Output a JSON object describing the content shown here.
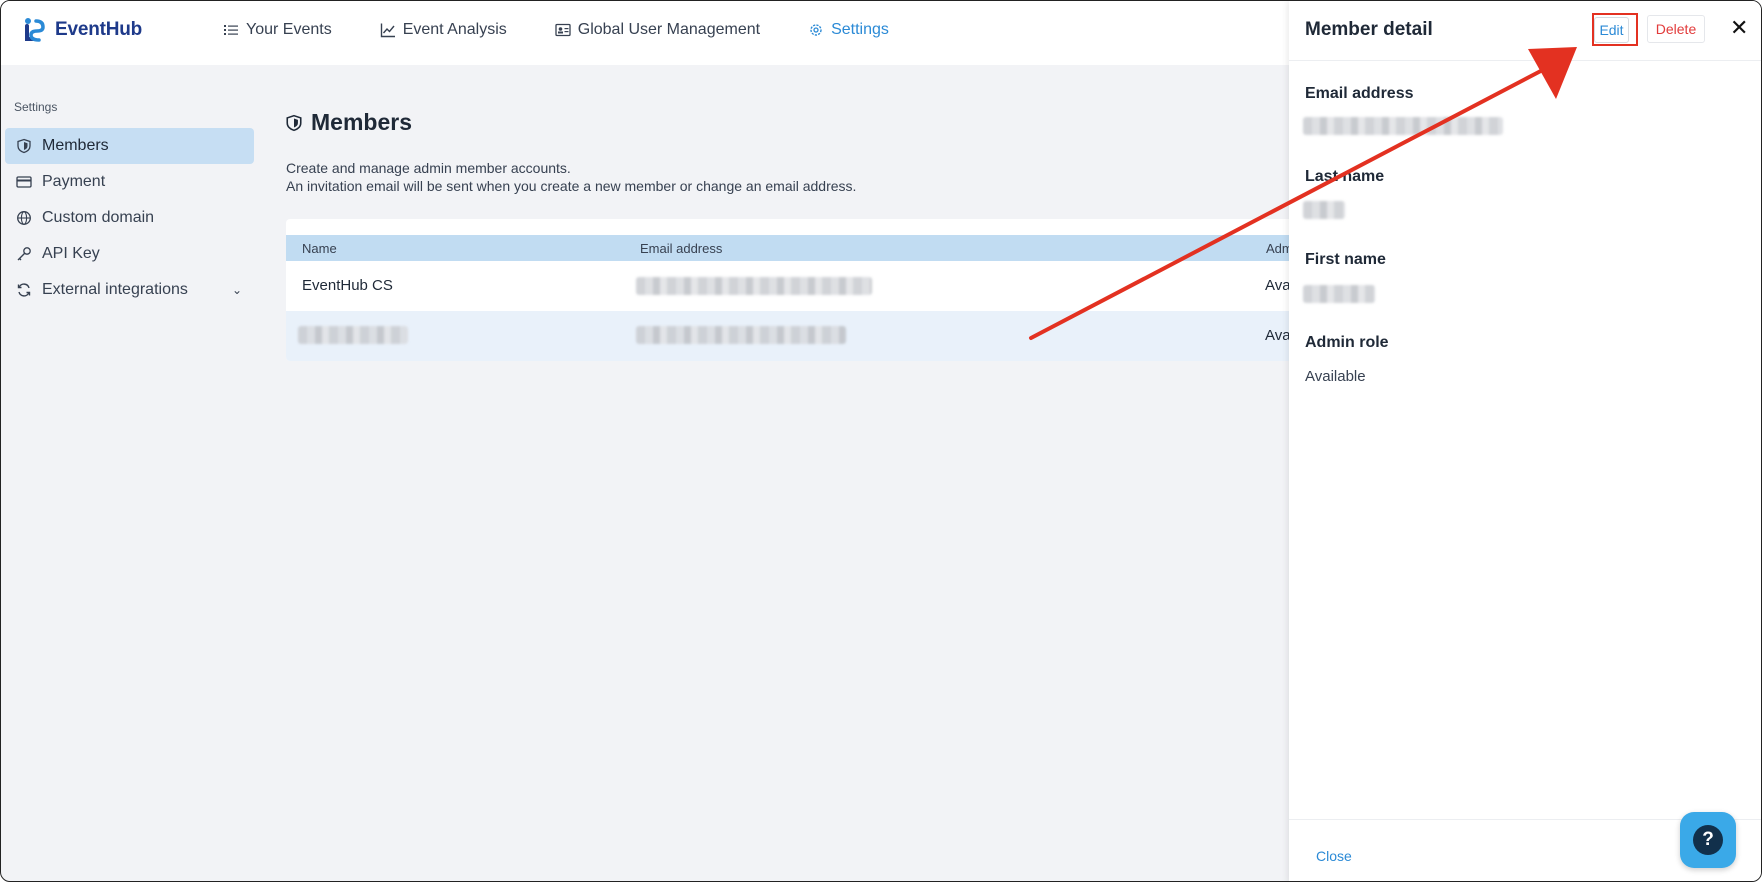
{
  "app": {
    "name": "EventHub",
    "accent": "#2b8ad6",
    "annotation_color": "#e33121"
  },
  "nav": {
    "items": [
      {
        "label": "Your Events",
        "icon": "list-icon"
      },
      {
        "label": "Event Analysis",
        "icon": "line-chart-icon"
      },
      {
        "label": "Global User Management",
        "icon": "id-card-icon"
      },
      {
        "label": "Settings",
        "icon": "gear-icon",
        "active": true
      }
    ]
  },
  "sidebar": {
    "heading": "Settings",
    "items": [
      {
        "label": "Members",
        "icon": "shield-icon",
        "active": true
      },
      {
        "label": "Payment",
        "icon": "credit-card-icon"
      },
      {
        "label": "Custom domain",
        "icon": "globe-icon"
      },
      {
        "label": "API Key",
        "icon": "key-icon"
      },
      {
        "label": "External integrations",
        "icon": "sync-icon",
        "expandable": true
      }
    ]
  },
  "main": {
    "title": "Members",
    "description_1": "Create and manage admin member accounts.",
    "description_2": "An invitation email will be sent when you create a new member or change an email address.",
    "table": {
      "columns": [
        "Name",
        "Email address",
        "Adm"
      ],
      "rows": [
        {
          "name": "EventHub CS",
          "admin_role": "Ava"
        },
        {
          "name": "",
          "admin_role": "Ava"
        }
      ]
    }
  },
  "drawer": {
    "title": "Member detail",
    "edit_label": "Edit",
    "delete_label": "Delete",
    "close_icon": "close-icon",
    "fields": {
      "email_label": "Email address",
      "last_name_label": "Last name",
      "first_name_label": "First name",
      "admin_role_label": "Admin role",
      "admin_role_value": "Available"
    },
    "footer_close": "Close"
  },
  "help": {
    "icon": "question-icon",
    "glyph": "?"
  }
}
